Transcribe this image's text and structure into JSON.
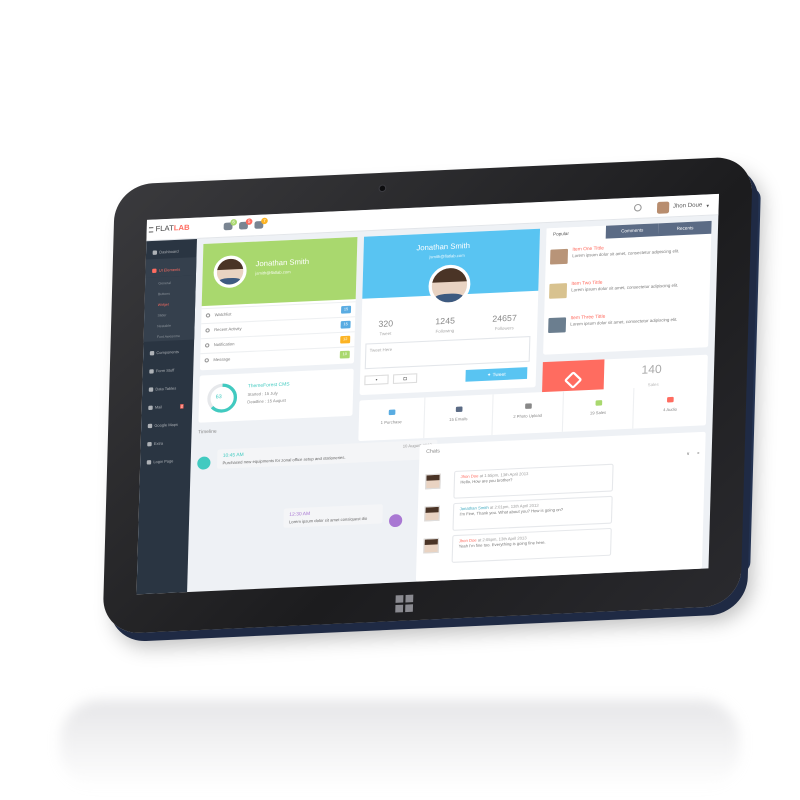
{
  "app": {
    "logo_part1": "FLAT",
    "logo_part2": "LAB",
    "user_name": "Jhon Doue"
  },
  "notifications": [
    {
      "icon": "tasks-icon",
      "count": "6",
      "color": "#a9d86e"
    },
    {
      "icon": "mail-icon",
      "count": "5",
      "color": "#ff6c60"
    },
    {
      "icon": "bell-icon",
      "count": "7",
      "color": "#fcb322"
    }
  ],
  "sidebar": {
    "items": [
      {
        "label": "Dashboard"
      },
      {
        "label": "UI Elements"
      },
      {
        "label": "Components"
      },
      {
        "label": "Form Stuff"
      },
      {
        "label": "Data Tables"
      },
      {
        "label": "Mail",
        "badge": "2"
      },
      {
        "label": "Google Maps"
      },
      {
        "label": "Extra"
      },
      {
        "label": "Login Page"
      }
    ],
    "sub_items": [
      "General",
      "Buttons",
      "Widget",
      "Slider",
      "Nestable",
      "Font Awesome"
    ]
  },
  "profile_card": {
    "name": "Jonathan Smith",
    "email": "jsmith@flatlab.com",
    "items": [
      {
        "label": "Watchlist",
        "count": "15",
        "color": "#59ace2"
      },
      {
        "label": "Recent Activity",
        "count": "15",
        "color": "#59ace2"
      },
      {
        "label": "Notification",
        "count": "12",
        "color": "#fcb322"
      },
      {
        "label": "Message",
        "count": "10",
        "color": "#a9d86e"
      }
    ]
  },
  "twitter_card": {
    "name": "Jonathan Smith",
    "email": "jsmith@flatlab.com",
    "stats": [
      {
        "value": "320",
        "label": "Tweet"
      },
      {
        "value": "1245",
        "label": "Following"
      },
      {
        "value": "24657",
        "label": "Followers"
      }
    ],
    "placeholder": "Tweet Here",
    "tweet_label": "Tweet"
  },
  "popular_card": {
    "tabs": [
      "Popular",
      "Comments",
      "Recents"
    ],
    "items": [
      {
        "title": "Item One Tittle",
        "text": "Lorem ipsum dolor sit amet, consectetur adipiscing elit."
      },
      {
        "title": "Item Two Tittle",
        "text": "Lorem ipsum dolor sit amet, consectetur adipiscing elit."
      },
      {
        "title": "Item Three Tittle",
        "text": "Lorem ipsum dolor sit amet, consectetur adipiscing elit."
      }
    ]
  },
  "sales_card": {
    "value": "140",
    "label": "Sales"
  },
  "progress_card": {
    "percent": "63",
    "fraction": 0.63,
    "title": "ThemeForest CMS",
    "started": "Started : 15 July",
    "deadline": "Deadline : 15 August"
  },
  "shortcuts": [
    {
      "label": "1 Purchase",
      "color": "#59ace2"
    },
    {
      "label": "15 Emails",
      "color": "#5b6b85"
    },
    {
      "label": "2 Photo Upload",
      "color": "#888"
    },
    {
      "label": "19 Sales",
      "color": "#a9d86e"
    },
    {
      "label": "4 Audio",
      "color": "#ff6c60"
    }
  ],
  "timeline": {
    "title": "Timeline",
    "events": [
      {
        "time": "10:45 AM",
        "date": "10 August 2013",
        "text": "Purchased new equipments for zonal office setup and stationeries."
      },
      {
        "time": "12:30 AM",
        "date": "",
        "text": "Lorem ipsum dolor sit amet consiquest dio"
      }
    ]
  },
  "chats": {
    "title": "Chats",
    "messages": [
      {
        "name": "Jhon Doe",
        "time": "at 1:55pm, 13th April 2013",
        "text": "Hello, How are you brother?"
      },
      {
        "name": "Jonathan Smith",
        "time": "at 2:01pm, 13th April 2013",
        "text": "I'm Fine, Thank you. What about you? How is going on?"
      },
      {
        "name": "Jhon Doe",
        "time": "at 2:05pm, 13th April 2013",
        "text": "Yeah I'm fine too. Everything is going fine here."
      }
    ]
  }
}
